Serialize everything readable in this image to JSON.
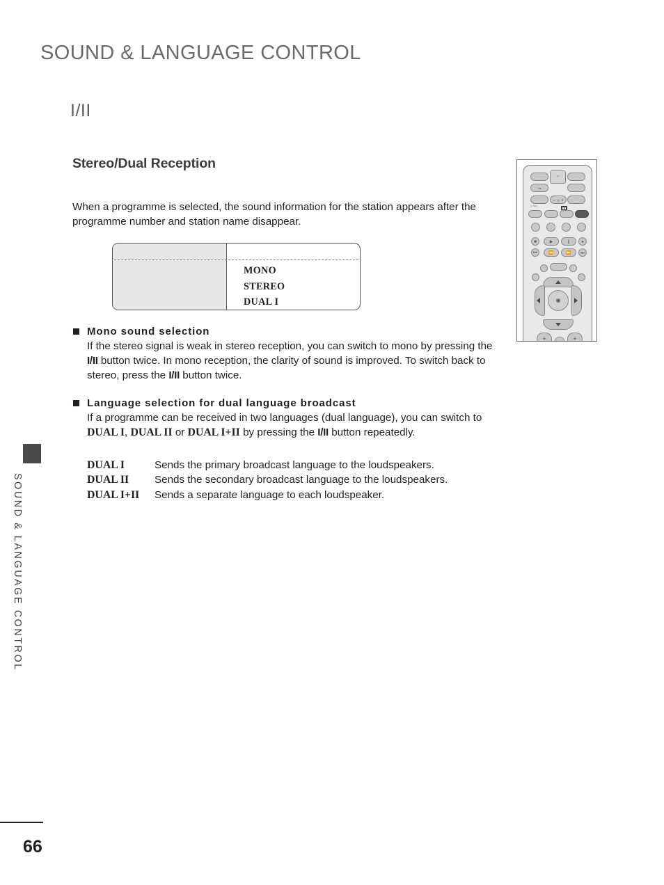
{
  "page": {
    "header": "SOUND & LANGUAGE CONTROL",
    "section_title": "I/II",
    "sub_heading": "Stereo/Dual Reception",
    "number": "66",
    "side_tab_label": "SOUND & LANGUAGE CONTROL"
  },
  "intro": {
    "paragraph": "When a programme is selected, the sound information for the station appears after the programme number and station name disappear."
  },
  "osd_box": {
    "items": [
      "MONO",
      "STEREO",
      "DUAL I"
    ]
  },
  "sections": [
    {
      "heading": "Mono sound selection",
      "body_part_1": "If the stereo signal is weak in stereo reception, you can switch to mono by pressing the ",
      "body_key_1": "I/II",
      "body_part_2": " button twice. In mono reception, the clarity of sound is improved. To switch back to stereo, press the ",
      "body_key_2": "I/II",
      "body_part_3": " button twice."
    },
    {
      "heading": "Language selection for dual language broadcast",
      "body_part_1": "If  a programme can be received in two languages (dual language), you can switch to ",
      "term_1": "DUAL I",
      "sep_1": ", ",
      "term_2": "DUAL II",
      "sep_2": " or ",
      "term_3": "DUAL I+II",
      "body_part_2": " by pressing the ",
      "body_key_1": "I/II",
      "body_part_3": " button repeatedly."
    }
  ],
  "definitions": [
    {
      "term": "DUAL I",
      "description": "Sends the primary broadcast language to the loudspeakers."
    },
    {
      "term": "DUAL II",
      "description": "Sends the secondary broadcast language to the loudspeakers."
    },
    {
      "term": "DUAL I+II",
      "description": "Sends a separate language to each loudspeaker."
    }
  ],
  "remote": {
    "tiny_label": "Q.VIEW",
    "iii_badge_label": "I/II"
  },
  "colors": {
    "header_gray": "#6a6a6a",
    "body_black": "#231f20",
    "tab_dark": "#4a4a4a",
    "osd_panel_gray": "#e7e7e7",
    "remote_body": "#e9e9e9",
    "remote_button": "#c8c8c8"
  }
}
